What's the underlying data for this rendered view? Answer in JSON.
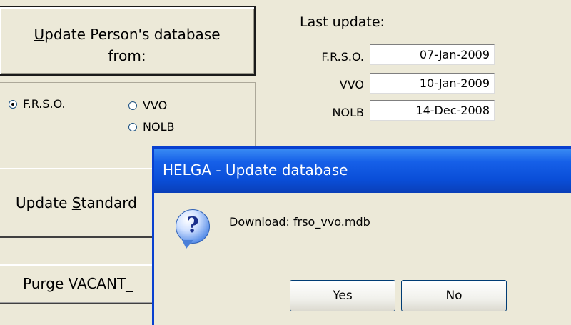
{
  "left_panel": {
    "update_person_button": {
      "line1_pre": "",
      "line1_ul": "U",
      "line1_rest": "pdate Person's database",
      "line2": "from:"
    },
    "radio_options": [
      {
        "label": "F.R.S.O.",
        "checked": true
      },
      {
        "label": "VVO",
        "checked": false
      },
      {
        "label": "NOLB",
        "checked": false
      }
    ],
    "update_standard_button": {
      "pre": "Update ",
      "ul": "S",
      "rest": "tandard"
    },
    "purge_button": {
      "label": "Purge VACANT_"
    }
  },
  "last_update": {
    "title": "Last update:",
    "rows": [
      {
        "label": "F.R.S.O.",
        "value": "07-Jan-2009"
      },
      {
        "label": "VVO",
        "value": "10-Jan-2009"
      },
      {
        "label": "NOLB",
        "value": "14-Dec-2008"
      }
    ]
  },
  "dialog": {
    "title": "HELGA - Update database",
    "icon": "question-icon",
    "icon_glyph": "?",
    "message": "Download: frso_vvo.mdb",
    "buttons": {
      "yes": "Yes",
      "no": "No"
    }
  }
}
